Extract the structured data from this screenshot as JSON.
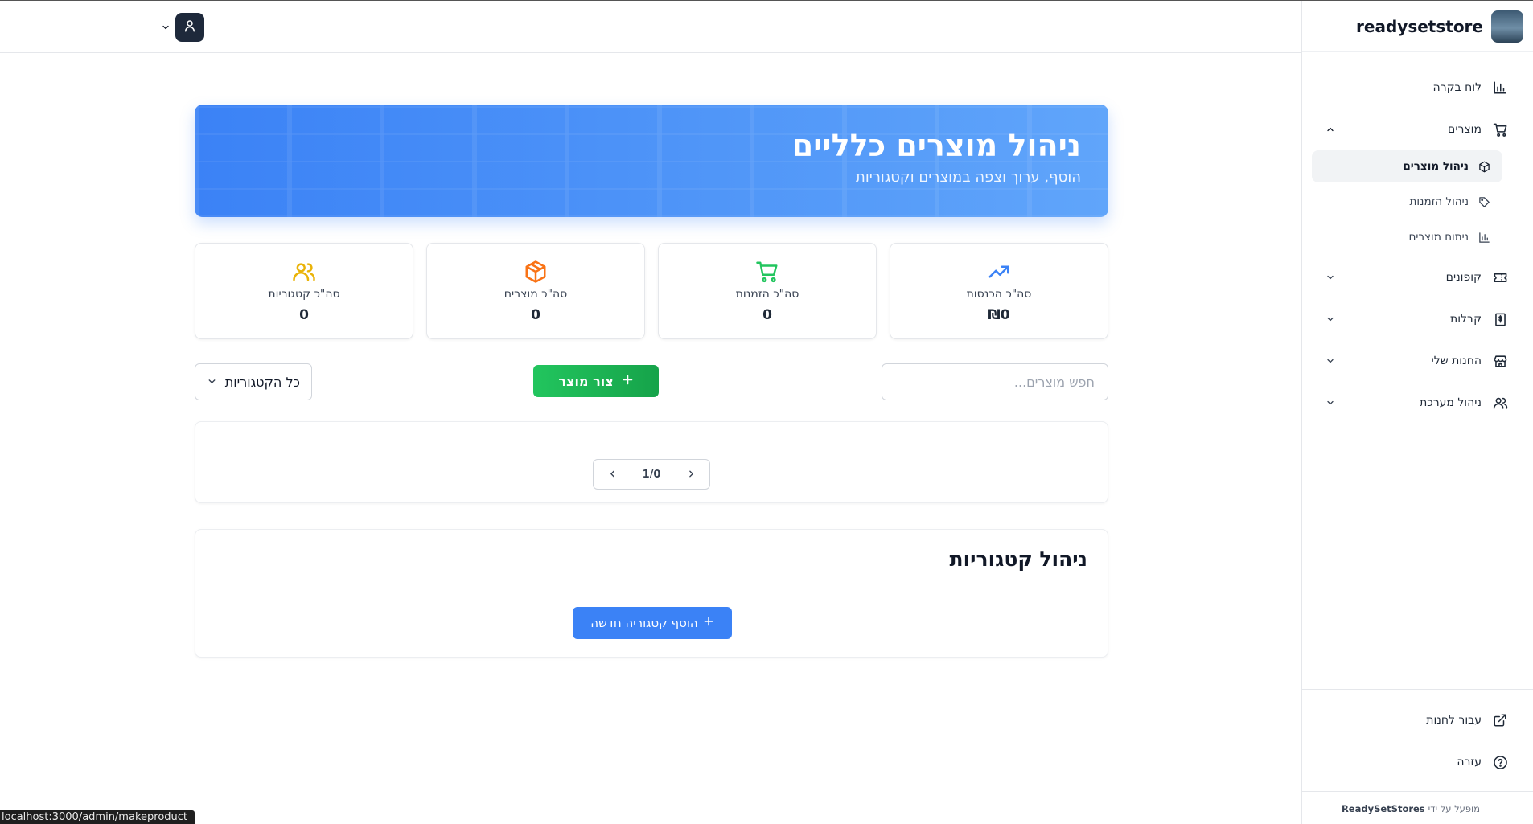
{
  "brand": {
    "name": "readysetstore"
  },
  "sidebar": {
    "items": [
      {
        "label": "לוח בקרה",
        "icon": "bar-chart-icon"
      },
      {
        "label": "מוצרים",
        "icon": "cart-icon",
        "expanded": true,
        "children": [
          {
            "label": "ניהול מוצרים",
            "icon": "package-icon",
            "active": true
          },
          {
            "label": "ניהול הזמנות",
            "icon": "tag-icon"
          },
          {
            "label": "ניתוח מוצרים",
            "icon": "bar-chart-icon"
          }
        ]
      },
      {
        "label": "קופונים",
        "icon": "ticket-icon",
        "expanded": false
      },
      {
        "label": "קבלות",
        "icon": "receipt-icon",
        "expanded": false
      },
      {
        "label": "החנות שלי",
        "icon": "store-icon",
        "expanded": false
      },
      {
        "label": "ניהול מערכת",
        "icon": "users-icon",
        "expanded": false
      }
    ],
    "bottom": [
      {
        "label": "עבור לחנות",
        "icon": "external-link-icon"
      },
      {
        "label": "עזרה",
        "icon": "help-circle-icon"
      }
    ],
    "footer": {
      "prefix": "מופעל על ידי",
      "brand": "ReadySetStores"
    }
  },
  "hero": {
    "title": "ניהול מוצרים כלליים",
    "subtitle": "הוסף, ערוך וצפה במוצרים וקטגוריות"
  },
  "stats": [
    {
      "label": "סה\"כ הכנסות",
      "value": "₪0",
      "icon": "trending-up-icon",
      "color": "#3b82f6"
    },
    {
      "label": "סה\"כ הזמנות",
      "value": "0",
      "icon": "cart-icon",
      "color": "#22c55e"
    },
    {
      "label": "סה\"כ מוצרים",
      "value": "0",
      "icon": "package-icon",
      "color": "#f97316"
    },
    {
      "label": "סה\"כ קטגוריות",
      "value": "0",
      "icon": "users-icon",
      "color": "#eab308"
    }
  ],
  "controls": {
    "search_placeholder": "חפש מוצרים...",
    "create_label": "צור מוצר",
    "category_filter": "כל הקטגוריות"
  },
  "pager": {
    "label": "1/0"
  },
  "categories": {
    "title": "ניהול קטגוריות",
    "add_label": "הוסף קטגוריה חדשה"
  },
  "status_url": "localhost:3000/admin/makeproduct"
}
